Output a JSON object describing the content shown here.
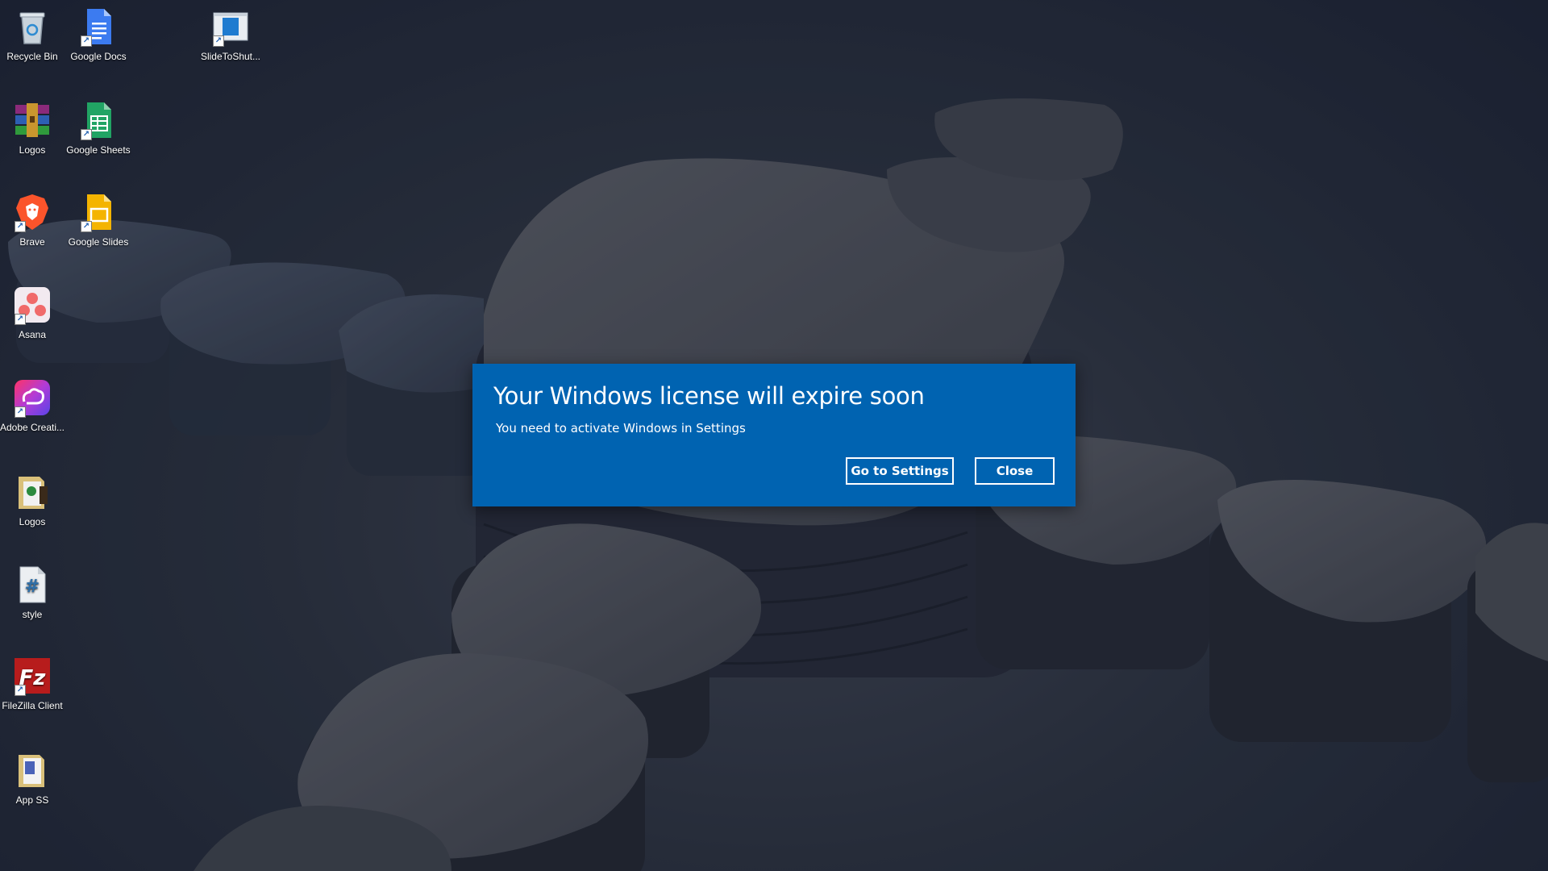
{
  "desktop": {
    "icons": [
      {
        "label": "Recycle Bin",
        "icon": "recycle-bin-icon"
      },
      {
        "label": "Google Docs",
        "icon": "google-docs-icon"
      },
      {
        "label": "SlideToShut...",
        "icon": "slide-to-shutdown-icon"
      },
      {
        "label": "Logos",
        "icon": "winrar-archive-icon"
      },
      {
        "label": "Google Sheets",
        "icon": "google-sheets-icon"
      },
      {
        "label": "Brave",
        "icon": "brave-browser-icon"
      },
      {
        "label": "Google Slides",
        "icon": "google-slides-icon"
      },
      {
        "label": "Asana",
        "icon": "asana-icon"
      },
      {
        "label": "Adobe Creati...",
        "icon": "adobe-creative-cloud-icon"
      },
      {
        "label": "Logos",
        "icon": "folder-logos-icon"
      },
      {
        "label": "style",
        "icon": "css-file-icon"
      },
      {
        "label": "FileZilla Client",
        "icon": "filezilla-icon"
      },
      {
        "label": "App SS",
        "icon": "folder-icon"
      }
    ]
  },
  "dialog": {
    "title": "Your Windows license will expire soon",
    "message": "You need to activate Windows in Settings",
    "primary_button": "Go to Settings",
    "secondary_button": "Close",
    "background_color": "#0063b1"
  }
}
